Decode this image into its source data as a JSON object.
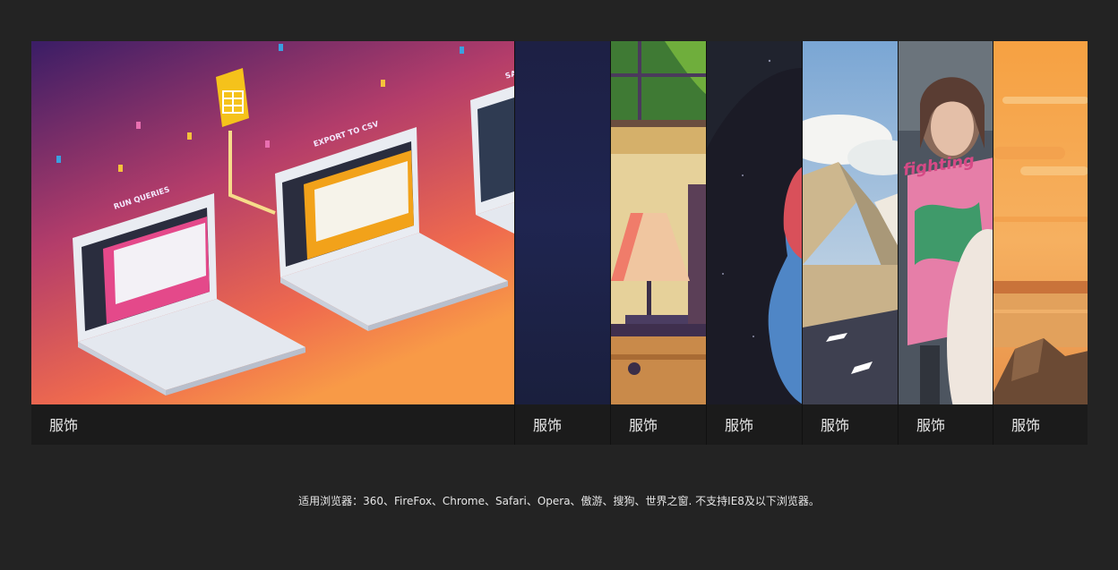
{
  "panels": [
    {
      "caption": "服饰",
      "labels": {
        "run": "RUN QUERIES",
        "export": "EXPORT TO CSV",
        "third": "SA"
      }
    },
    {
      "caption": "服饰"
    },
    {
      "caption": "服饰"
    },
    {
      "caption": "服饰"
    },
    {
      "caption": "服饰"
    },
    {
      "caption": "服饰",
      "sign": "fighting"
    },
    {
      "caption": "服饰"
    }
  ],
  "footer": {
    "text": "适用浏览器：360、FireFox、Chrome、Safari、Opera、傲游、搜狗、世界之窗. 不支持IE8及以下浏览器。"
  }
}
